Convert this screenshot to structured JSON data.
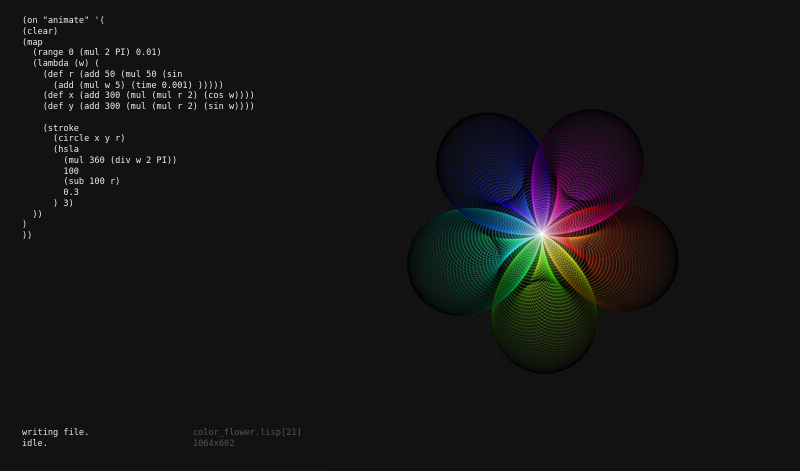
{
  "editor": {
    "code_lines": [
      "(on \"animate\" '(",
      "(clear)",
      "(map",
      "  (range 0 (mul 2 PI) 0.01)",
      "  (lambda (w) (",
      "    (def r (add 50 (mul 50 (sin",
      "      (add (mul w 5) (time 0.001) )))))",
      "    (def x (add 300 (mul (mul r 2) (cos w))))",
      "    (def y (add 300 (mul (mul r 2) (sin w))))",
      "",
      "    (stroke",
      "      (circle x y r)",
      "      (hsla",
      "        (mul 360 (div w 2 PI))",
      "        100",
      "        (sub 100 r)",
      "        0.3",
      "      ) 3)",
      "  ))",
      ")",
      "))"
    ]
  },
  "status": {
    "message": "writing file.",
    "state": "idle."
  },
  "file": {
    "name": "color_flower.lisp[21]",
    "dimensions": "1064x602"
  },
  "canvas": {
    "background": "#121212",
    "petals": 5,
    "stroke_alpha": 0.3,
    "stroke_width": 3
  }
}
